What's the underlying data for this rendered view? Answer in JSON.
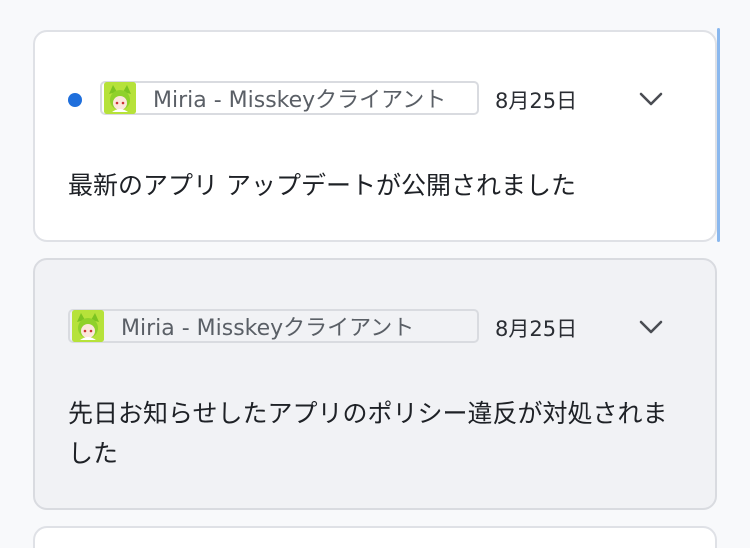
{
  "notifications": [
    {
      "unread": true,
      "app_name": "Miria - Misskeyクライアント",
      "date": "8月25日",
      "message": "最新のアプリ アップデートが公開されました",
      "expand_icon": "chevron-down-icon"
    },
    {
      "unread": false,
      "app_name": "Miria - Misskeyクライアント",
      "date": "8月25日",
      "message": "先日お知らせしたアプリのポリシー違反が対処されました",
      "expand_icon": "chevron-down-icon"
    }
  ],
  "colors": {
    "unread_dot": "#1f6fdc",
    "card_background": "#ffffff",
    "read_card_background": "#f1f2f5",
    "app_icon_green": "#b6e23a",
    "scroll_indicator": "#8ab8ee"
  },
  "icons": {
    "app": "miria-app-icon",
    "expand": "chevron-down-icon"
  }
}
